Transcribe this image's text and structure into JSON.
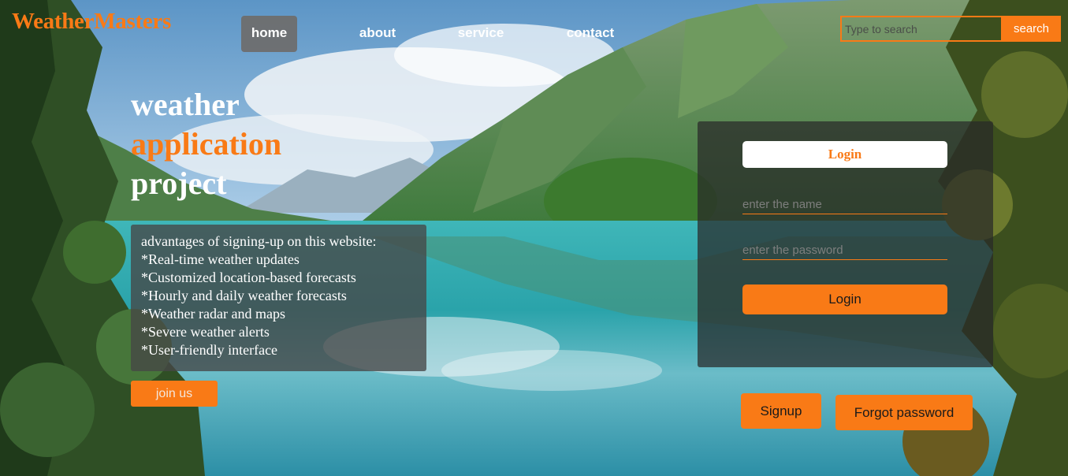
{
  "brand": {
    "name": "WeatherMasters"
  },
  "nav": {
    "items": [
      {
        "label": "home"
      },
      {
        "label": "about"
      },
      {
        "label": "service"
      },
      {
        "label": "contact"
      }
    ]
  },
  "search": {
    "placeholder": "Type to search",
    "button_label": "search"
  },
  "hero": {
    "line1": "weather",
    "line2": "application",
    "line3": "project"
  },
  "advantages": {
    "heading": "advantages of signing-up on this website:",
    "items": [
      "*Real-time weather updates",
      "*Customized location-based forecasts",
      "*Hourly and daily weather forecasts",
      "*Weather radar and maps",
      "*Severe weather alerts",
      "*User-friendly interface"
    ],
    "join_label": "join us"
  },
  "login": {
    "title": "Login",
    "name_placeholder": "enter the name",
    "password_placeholder": "enter the password",
    "submit_label": "Login",
    "signup_label": "Signup",
    "forgot_label": "Forgot password"
  },
  "colors": {
    "accent": "#f97a16",
    "nav_active": "#6e6e6e",
    "panel": "#282828"
  },
  "background": {
    "scene": "lake-valley-mountains-trees"
  }
}
